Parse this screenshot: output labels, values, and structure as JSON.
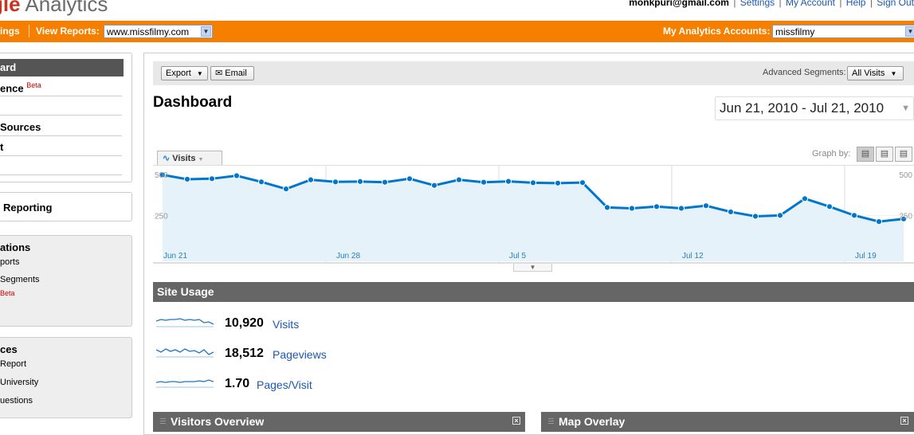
{
  "header": {
    "logo_part1": "gle",
    "logo_part2": "Analytics",
    "user_email": "monkpuri@gmail.com",
    "links": [
      "Settings",
      "My Account",
      "Help",
      "Sign Out"
    ]
  },
  "orangebar": {
    "settings_label": "ings",
    "view_reports_label": "View Reports:",
    "view_reports_value": "www.missfilmy.com",
    "accounts_label": "My Analytics Accounts:",
    "accounts_value": "missfilmy"
  },
  "sidebar": {
    "dashboard": "ard",
    "intelligence": "ence",
    "intelligence_badge": "Beta",
    "traffic_sources": "Sources",
    "content": "t",
    "custom_reporting": "Reporting",
    "my_customizations_heading": "ations",
    "custom_reports": "ports",
    "advanced_segments": "Segments",
    "beta_tag": "Beta",
    "resources_heading": "ces",
    "report": "Report",
    "university": "University",
    "questions": "uestions"
  },
  "toolbar": {
    "export_label": "Export",
    "email_label": "Email",
    "advanced_segments_label": "Advanced Segments:",
    "advanced_segments_value": "All Visits"
  },
  "page": {
    "title": "Dashboard",
    "date_range": "Jun 21, 2010 - Jul 21, 2010"
  },
  "graph": {
    "metric_tab": "Visits",
    "graph_by_label": "Graph by:"
  },
  "chart_data": {
    "type": "line",
    "x_tick_labels": [
      "Jun 21",
      "Jun 28",
      "Jul 5",
      "Jul 12",
      "Jul 19"
    ],
    "y_tick_labels": [
      "500",
      "250"
    ],
    "ylim": [
      0,
      500
    ],
    "grid": true,
    "values": [
      480,
      455,
      458,
      475,
      440,
      400,
      452,
      440,
      442,
      438,
      458,
      420,
      452,
      438,
      443,
      435,
      433,
      436,
      295,
      290,
      300,
      290,
      305,
      270,
      245,
      250,
      345,
      300,
      250,
      215,
      230
    ]
  },
  "site_usage": {
    "heading": "Site Usage",
    "rows": [
      {
        "value": "10,920",
        "label": "Visits"
      },
      {
        "value": "18,512",
        "label": "Pageviews"
      },
      {
        "value": "1.70",
        "label": "Pages/Visit"
      }
    ]
  },
  "widgets": {
    "visitors_overview": "Visitors Overview",
    "map_overlay": "Map Overlay"
  },
  "colors": {
    "orange_bar": "#f77f00",
    "chart_line": "#0077cc",
    "chart_fill": "#e5f2fa",
    "section_bar": "#666666",
    "link_blue": "#1b57b1"
  }
}
